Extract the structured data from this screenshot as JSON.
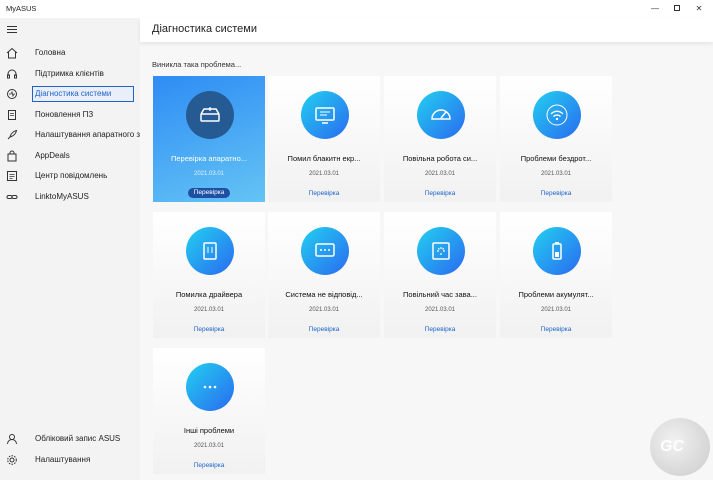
{
  "app": {
    "title": "MyASUS"
  },
  "window": {
    "minimize": "—",
    "close": "✕"
  },
  "sidebar": {
    "items": [
      {
        "label": "Головна",
        "icon": "home-icon"
      },
      {
        "label": "Підтримка клієнтів",
        "icon": "headset-icon"
      },
      {
        "label": "Діагностика системи",
        "icon": "diagnostics-icon",
        "active": true
      },
      {
        "label": "Поновлення ПЗ",
        "icon": "document-icon"
      },
      {
        "label": "Налаштування апаратного з",
        "icon": "rocket-icon"
      },
      {
        "label": "AppDeals",
        "icon": "bag-icon"
      },
      {
        "label": "Центр повідомлень",
        "icon": "message-icon"
      },
      {
        "label": "LinktoMyASUS",
        "icon": "link-icon"
      }
    ],
    "bottom_items": [
      {
        "label": "Обліковий запис ASUS",
        "icon": "user-icon"
      },
      {
        "label": "Налаштування",
        "icon": "gear-icon"
      }
    ]
  },
  "main": {
    "title": "Діагностика системи",
    "problem_label": "Виникла така проблема..."
  },
  "cards": [
    {
      "title": "Перевірка апаратно...",
      "date": "2021.03.01",
      "action": "Перевірка",
      "icon": "hardware-drive-icon",
      "active": true
    },
    {
      "title": "Помил блакитн екр...",
      "date": "2021.03.01",
      "action": "Перевірка",
      "icon": "monitor-icon"
    },
    {
      "title": "Повільна робота си...",
      "date": "2021.03.01",
      "action": "Перевірка",
      "icon": "speedometer-icon"
    },
    {
      "title": "Проблеми бездрот...",
      "date": "2021.03.01",
      "action": "Перевірка",
      "icon": "wifi-icon"
    },
    {
      "title": "Помилка драйвера",
      "date": "2021.03.01",
      "action": "Перевірка",
      "icon": "driver-icon"
    },
    {
      "title": "Система не відповід...",
      "date": "2021.03.01",
      "action": "Перевірка",
      "icon": "chat-dots-icon"
    },
    {
      "title": "Повільний час зава...",
      "date": "2021.03.01",
      "action": "Перевірка",
      "icon": "loading-icon"
    },
    {
      "title": "Проблеми акумулят...",
      "date": "2021.03.01",
      "action": "Перевірка",
      "icon": "battery-icon"
    },
    {
      "title": "Інші проблеми",
      "date": "2021.03.01",
      "action": "Перевірка",
      "icon": "more-dots-icon"
    }
  ],
  "colors": {
    "accent": "#1e64c8",
    "card_gradient_start": "#22d0f0",
    "card_gradient_end": "#2a6af0"
  }
}
